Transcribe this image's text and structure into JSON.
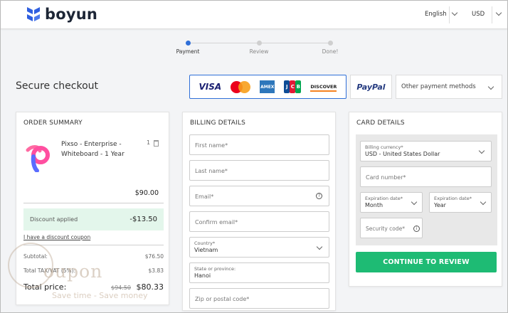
{
  "brand": {
    "name": "boyun"
  },
  "header": {
    "language": "English",
    "currency": "USD"
  },
  "steps": [
    {
      "label": "Payment",
      "active": true
    },
    {
      "label": "Review",
      "active": false
    },
    {
      "label": "Done!",
      "active": false
    }
  ],
  "page_title": "Secure checkout",
  "payment_methods": {
    "cards": [
      "VISA",
      "Mastercard",
      "AMEX",
      "JCB",
      "DISCOVER"
    ],
    "paypal": "PayPal",
    "other": "Other payment methods"
  },
  "order_summary": {
    "title": "ORDER SUMMARY",
    "product": "Pixso - Enterprise - Whiteboard - 1 Year",
    "quantity": "1",
    "line_price": "$90.00",
    "discount_label": "Discount applied",
    "discount_amount": "-$13.50",
    "coupon_link": "I have a discount coupon",
    "subtotal_label": "Subtotal:",
    "subtotal_value": "$76.50",
    "tax_label": "Total TAX/VAT (5%):",
    "tax_value": "$3.83",
    "total_label": "Total price:",
    "total_old": "$94.50",
    "total_value": "$80.33"
  },
  "billing": {
    "title": "BILLING DETAILS",
    "first_name": "First name*",
    "last_name": "Last name*",
    "email": "Email*",
    "confirm_email": "Confirm email*",
    "country_label": "Country*",
    "country_value": "Vietnam",
    "state_label": "State or province:",
    "state_value": "Hanoi",
    "zip": "Zip or postal code*"
  },
  "card_details": {
    "title": "CARD DETAILS",
    "currency_label": "Billing currency*",
    "currency_value": "USD - United States Dollar",
    "card_number": "Card number*",
    "exp_month_label": "Expiration date*",
    "exp_month_value": "Month",
    "exp_year_label": "Expiration date*",
    "exp_year_value": "Year",
    "security_code": "Security code*",
    "cta": "CONTINUE TO REVIEW"
  },
  "watermark": {
    "text": "oupon",
    "tagline": "Save time - Save money"
  },
  "colors": {
    "accent": "#2f6fd8",
    "cta": "#1ebb74",
    "discount_bg": "#e3f6eb"
  },
  "icons": [
    "boyun-logo",
    "chevron-down-icon",
    "trash-icon",
    "info-icon",
    "pixso-logo"
  ]
}
